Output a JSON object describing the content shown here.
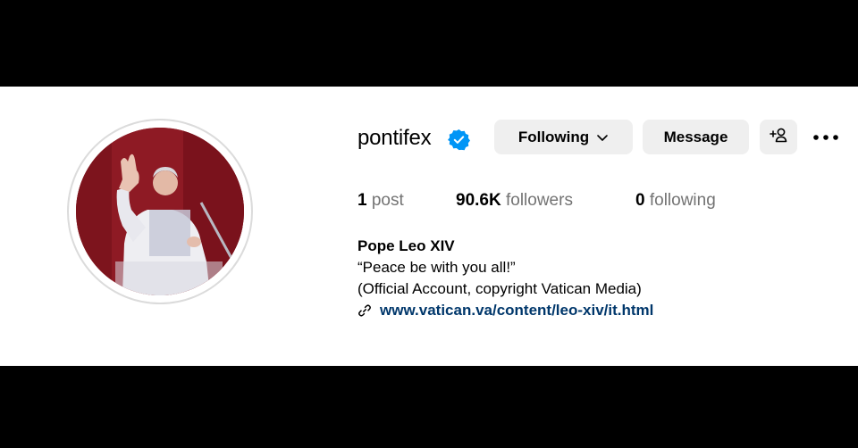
{
  "profile": {
    "username": "pontifex",
    "verified": true,
    "full_name": "Pope Leo XIV",
    "bio_lines": [
      "“Peace be with you all!”",
      "(Official Account, copyright Vatican Media)"
    ],
    "link": "www.vatican.va/content/leo-xiv/it.html"
  },
  "actions": {
    "following_label": "Following",
    "message_label": "Message"
  },
  "stats": {
    "posts_count": "1",
    "posts_label": "post",
    "followers_count": "90.6K",
    "followers_label": "followers",
    "following_count": "0",
    "following_label": "following"
  },
  "colors": {
    "verified_badge": "#0095f6",
    "link": "#00376b",
    "button_bg": "#efefef",
    "secondary_text": "#737373",
    "letterbox": "#000000"
  },
  "icons": {
    "verified": "verified-badge-icon",
    "chevron": "chevron-down-icon",
    "add_user": "add-user-icon",
    "more": "more-options-icon",
    "link": "link-icon"
  }
}
